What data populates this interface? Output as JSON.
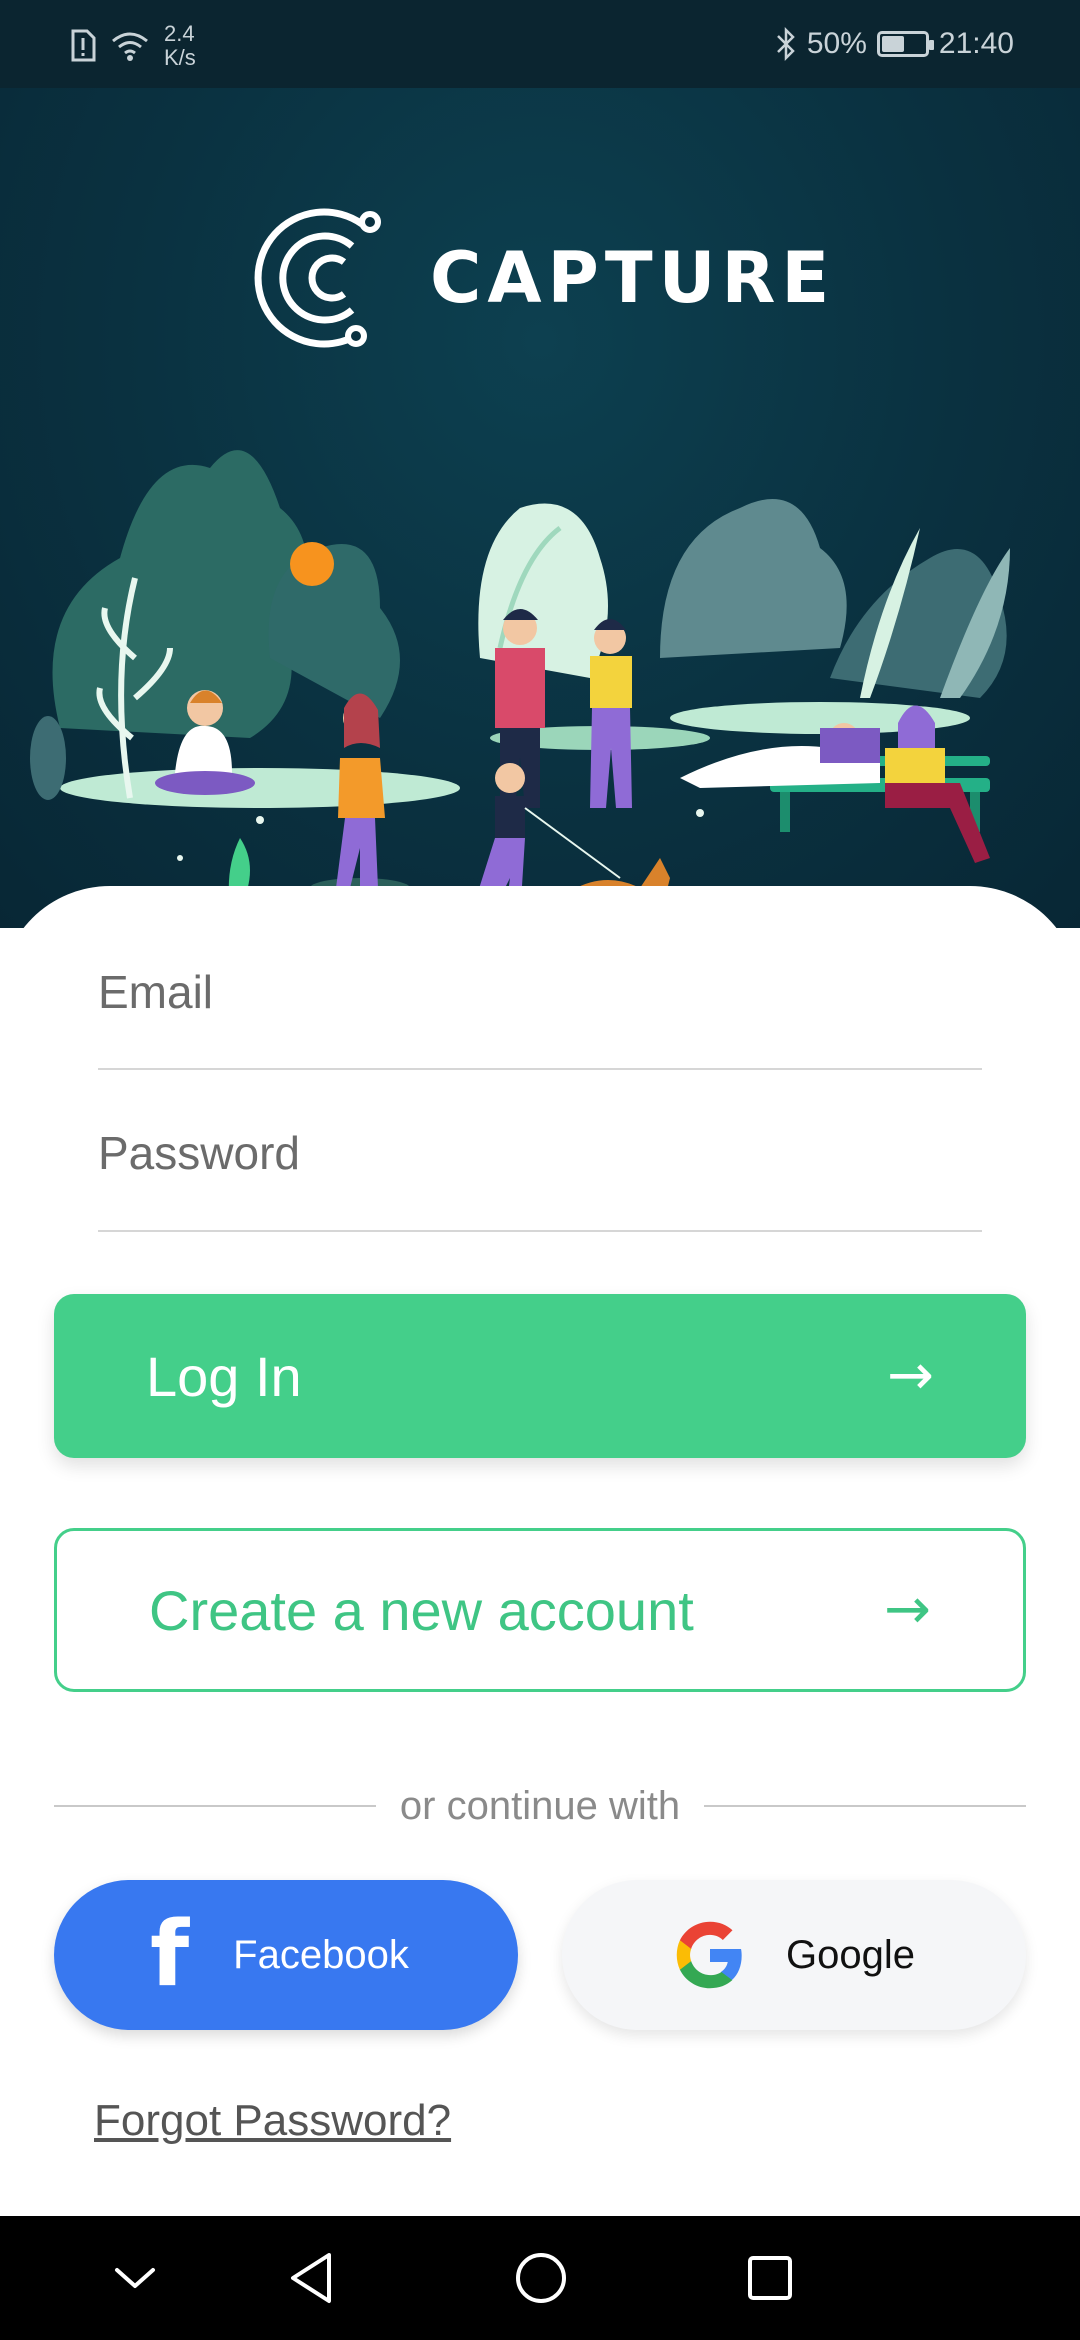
{
  "status_bar": {
    "speed_value": "2.4",
    "speed_unit": "K/s",
    "battery": "50%",
    "battery_level": 0.5,
    "time": "21:40"
  },
  "brand": {
    "name": "CAPTURE",
    "colors": {
      "hero_bg": "#0a3140",
      "accent": "#44cf8a",
      "facebook": "#3878f0"
    }
  },
  "form": {
    "email_placeholder": "Email",
    "password_placeholder": "Password"
  },
  "buttons": {
    "login_label": "Log In",
    "create_label": "Create a new account",
    "arrow_icon": "arrow-right-icon"
  },
  "divider": {
    "text": "or continue with"
  },
  "social": {
    "facebook_label": "Facebook",
    "google_label": "Google"
  },
  "links": {
    "forgot": "Forgot Password?"
  },
  "nav": {
    "icons": [
      "chevron-down-icon",
      "back-icon",
      "home-icon",
      "recents-icon"
    ]
  }
}
